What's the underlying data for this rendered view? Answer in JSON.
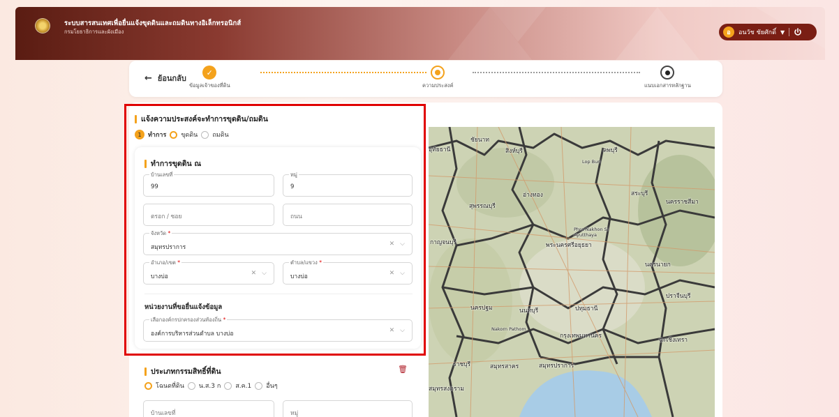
{
  "header": {
    "app_title": "ระบบสารสนเทศเพื่อยื่นแจ้งขุดดินและถมดินทางอิเล็กทรอนิกส์",
    "app_subtitle": "กรมโยธาธิการและผังเมือง",
    "user_initial": "อ",
    "user_name": "อนวัช ชัยศักดิ์",
    "colors": {
      "accent": "#f4a21c",
      "header_dark": "#5a1c12",
      "pill": "#7a1e14"
    }
  },
  "stepper": {
    "back_label": "ย้อนกลับ",
    "steps": [
      {
        "label": "ข้อมูลเจ้าของที่ดิน",
        "state": "done"
      },
      {
        "label": "ความประสงค์",
        "state": "current"
      },
      {
        "label": "แนบเอกสารหลักฐาน",
        "state": "pending"
      }
    ]
  },
  "form": {
    "section_title": "แจ้งความประสงค์จะทำการขุดดิน/ถมดิน",
    "item_number": "1",
    "action_label": "ทำการ",
    "options": [
      "ขุดดิน",
      "ถมดิน"
    ],
    "selected_option": "ขุดดิน",
    "location": {
      "title": "ทำการขุดดิน ณ",
      "house_no": {
        "label": "บ้านเลขที่",
        "value": "99"
      },
      "moo": {
        "label": "หมู่",
        "value": "9"
      },
      "soi": {
        "placeholder": "ตรอก / ซอย"
      },
      "road": {
        "placeholder": "ถนน"
      },
      "province": {
        "label": "จังหวัด",
        "value": "สมุทรปราการ"
      },
      "district": {
        "label": "อำเภอ/เขต",
        "value": "บางบ่อ"
      },
      "subdistrict": {
        "label": "ตำบล/แขวง",
        "value": "บางบ่อ"
      }
    },
    "agency": {
      "title": "หน่วยงานที่ขอยื่นแจ้งข้อมูล",
      "org": {
        "label": "เลือกองค์กรปกครองส่วนท้องถิ่น",
        "value": "องค์การบริหารส่วนตำบล บางบ่อ"
      }
    }
  },
  "land_rights": {
    "title": "ประเภทกรรมสิทธิ์ที่ดิน",
    "options": [
      "โฉนดที่ดิน",
      "น.ส.3 ก",
      "ส.ค.1",
      "อื่นๆ"
    ],
    "selected": "โฉนดที่ดิน",
    "house_no_placeholder": "บ้านเลขที่",
    "moo_placeholder": "หมู่"
  },
  "map": {
    "labels": [
      "ชัยนาท",
      "อุทัยธานี",
      "สิงห์บุรี",
      "ลพบุรี",
      "Lop Buri",
      "อ่างทอง",
      "สระบุรี",
      "สุพรรณบุรี",
      "นครราชสีมา",
      "Phra Nakhon Si Ayutthaya",
      "พระนครศรีอยุธยา",
      "กาญจนบุรี",
      "นครนายก",
      "ปทุมธานี",
      "ปราจีนบุรี",
      "นครปฐม",
      "นนทบุรี",
      "Nakorn Pathom",
      "กรุงเทพมหานคร",
      "ฉะเชิงเทรา",
      "ราชบุรี",
      "สมุทรสาคร",
      "สมุทรปราการ",
      "สมุทรสงคราม"
    ]
  }
}
